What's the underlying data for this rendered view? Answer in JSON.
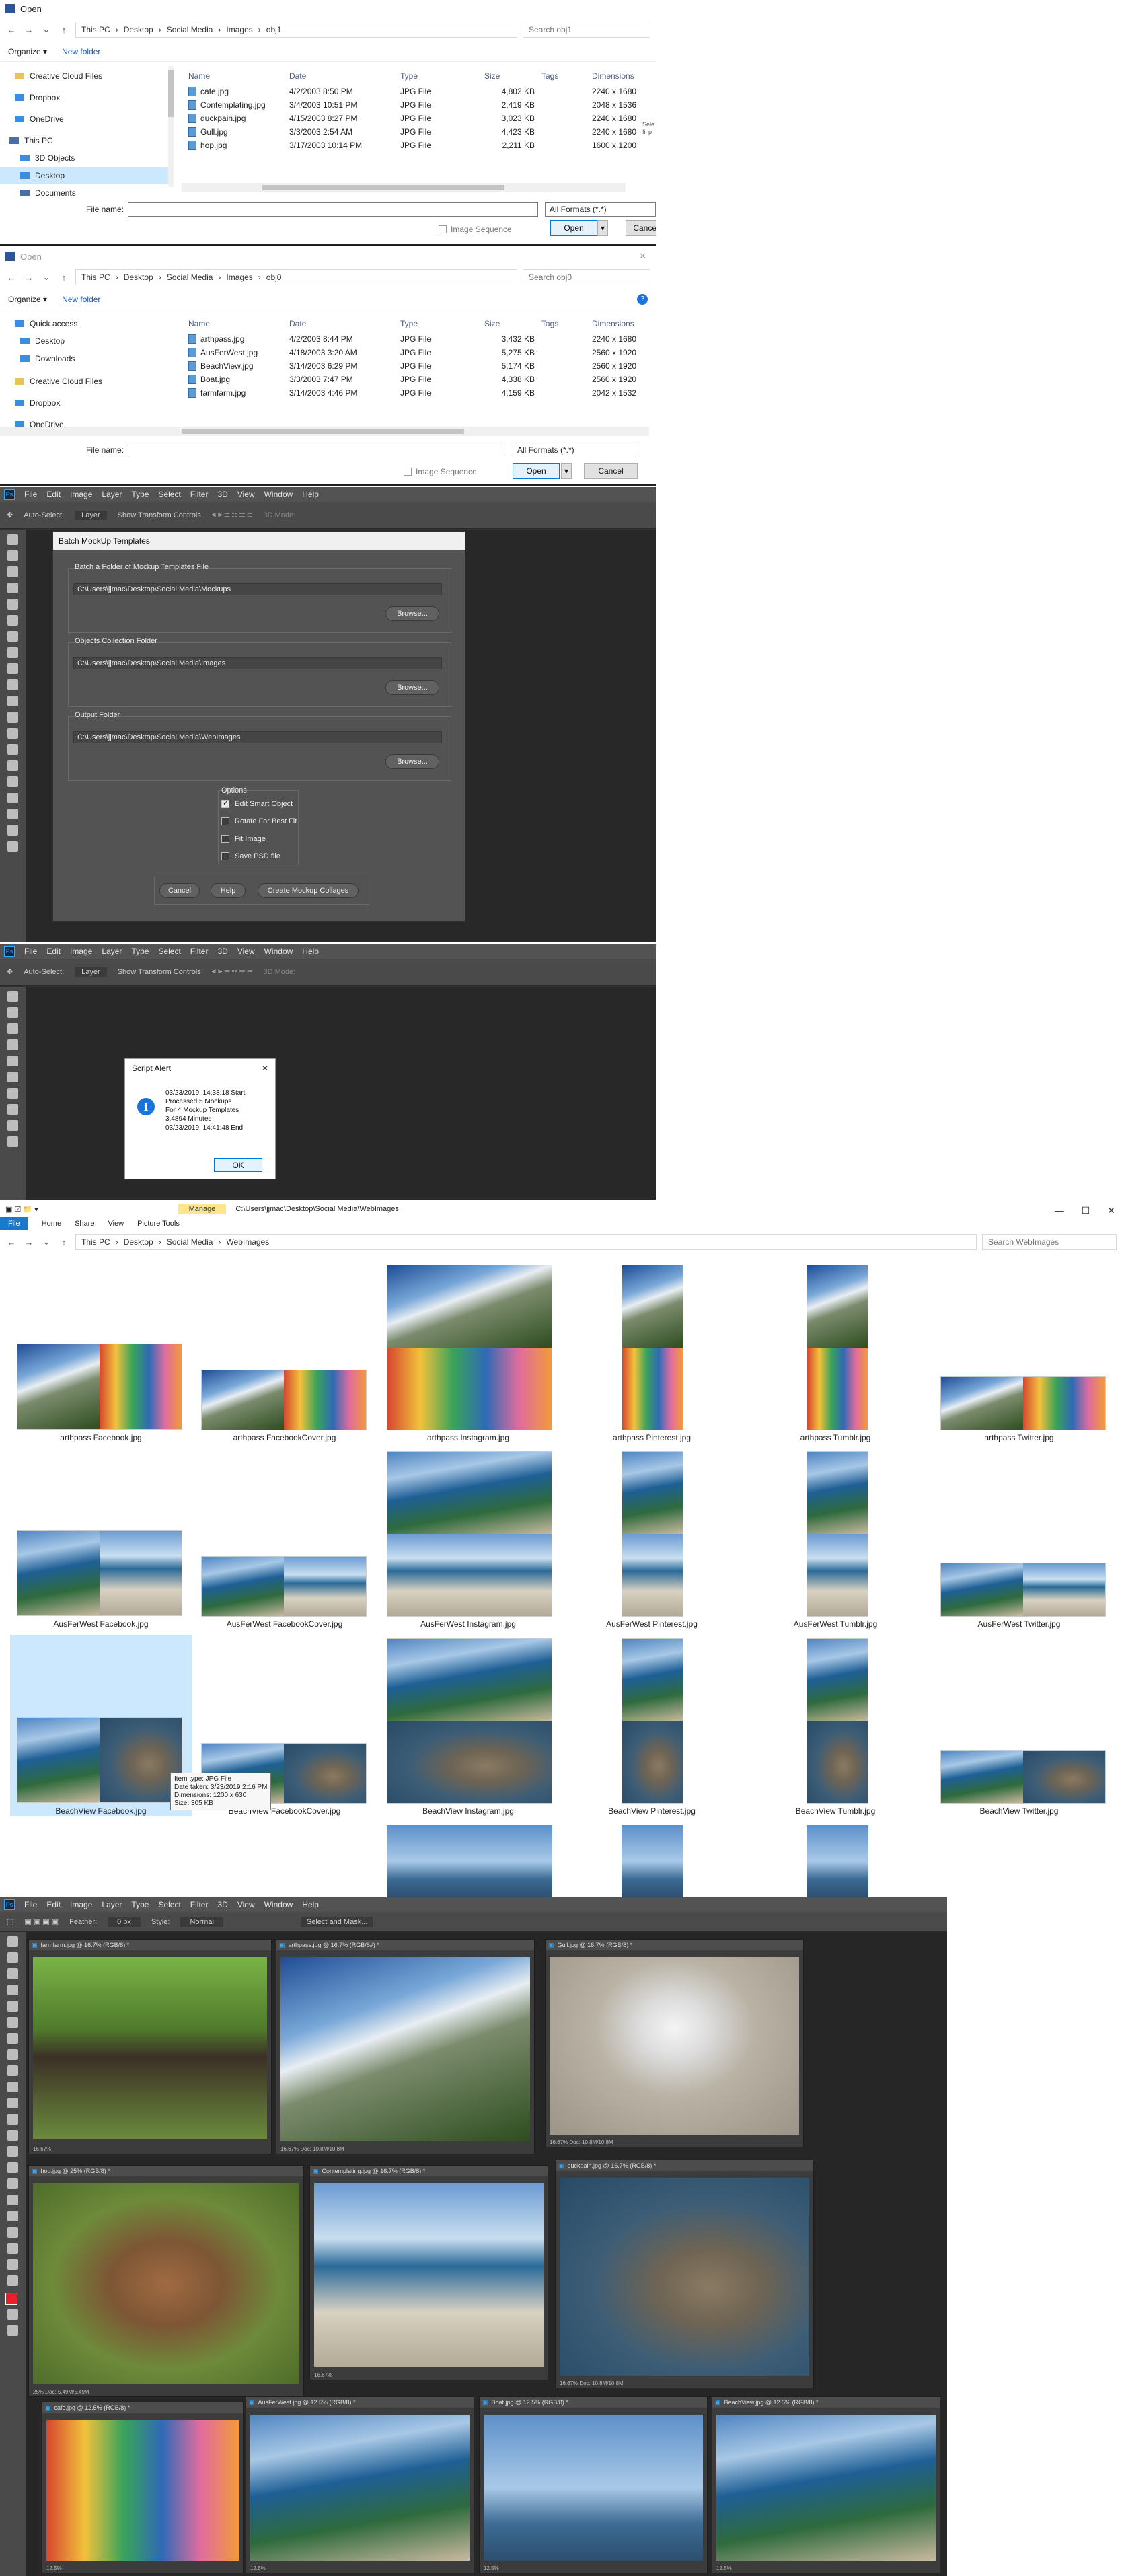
{
  "dialog1": {
    "title": "Open",
    "crumbs": [
      "This PC",
      "Desktop",
      "Social Media",
      "Images",
      "obj1"
    ],
    "search": "Search obj1",
    "organize": "Organize ▾",
    "new_folder": "New folder",
    "nav": [
      "Creative Cloud Files",
      "Dropbox",
      "OneDrive",
      "This PC",
      "3D Objects",
      "Desktop",
      "Documents"
    ],
    "headers": [
      "Name",
      "Date",
      "Type",
      "Size",
      "Tags",
      "Dimensions"
    ],
    "files": [
      {
        "name": "cafe.jpg",
        "date": "4/2/2003 8:50 PM",
        "type": "JPG File",
        "size": "4,802 KB",
        "dim": "2240 x 1680"
      },
      {
        "name": "Contemplating.jpg",
        "date": "3/4/2003 10:51 PM",
        "type": "JPG File",
        "size": "2,419 KB",
        "dim": "2048 x 1536"
      },
      {
        "name": "duckpain.jpg",
        "date": "4/15/2003 8:27 PM",
        "type": "JPG File",
        "size": "3,023 KB",
        "dim": "2240 x 1680"
      },
      {
        "name": "Gull.jpg",
        "date": "3/3/2003 2:54 AM",
        "type": "JPG File",
        "size": "4,423 KB",
        "dim": "2240 x 1680"
      },
      {
        "name": "hop.jpg",
        "date": "3/17/2003 10:14 PM",
        "type": "JPG File",
        "size": "2,211 KB",
        "dim": "1600 x 1200"
      }
    ],
    "file_name_label": "File name:",
    "formats": "All Formats (*.*)",
    "image_sequence": "Image Sequence",
    "open": "Open",
    "cancel": "Cancel",
    "preview_hint": "Sele",
    "preview_hint2": "fil p"
  },
  "dialog2": {
    "title": "Open",
    "crumbs": [
      "This PC",
      "Desktop",
      "Social Media",
      "Images",
      "obj0"
    ],
    "search": "Search obj0",
    "organize": "Organize ▾",
    "new_folder": "New folder",
    "nav": [
      "Quick access",
      "Desktop",
      "Downloads",
      "Creative Cloud Files",
      "Dropbox",
      "OneDrive"
    ],
    "headers": [
      "Name",
      "Date",
      "Type",
      "Size",
      "Tags",
      "Dimensions"
    ],
    "files": [
      {
        "name": "arthpass.jpg",
        "date": "4/2/2003 8:44 PM",
        "type": "JPG File",
        "size": "3,432 KB",
        "dim": "2240 x 1680"
      },
      {
        "name": "AusFerWest.jpg",
        "date": "4/18/2003 3:20 AM",
        "type": "JPG File",
        "size": "5,275 KB",
        "dim": "2560 x 1920"
      },
      {
        "name": "BeachView.jpg",
        "date": "3/14/2003 6:29 PM",
        "type": "JPG File",
        "size": "5,174 KB",
        "dim": "2560 x 1920"
      },
      {
        "name": "Boat.jpg",
        "date": "3/3/2003 7:47 PM",
        "type": "JPG File",
        "size": "4,338 KB",
        "dim": "2560 x 1920"
      },
      {
        "name": "farmfarm.jpg",
        "date": "3/14/2003 4:46 PM",
        "type": "JPG File",
        "size": "4,159 KB",
        "dim": "2042 x 1532"
      }
    ],
    "file_name_label": "File name:",
    "formats": "All Formats (*.*)",
    "image_sequence": "Image Sequence",
    "open": "Open",
    "cancel": "Cancel"
  },
  "ps_menu": [
    "File",
    "Edit",
    "Image",
    "Layer",
    "Type",
    "Select",
    "Filter",
    "3D",
    "View",
    "Window",
    "Help"
  ],
  "ps_opts": {
    "auto_select": "Auto-Select:",
    "layer": "Layer",
    "transform": "Show Transform Controls",
    "mode": "3D Mode:"
  },
  "batch": {
    "title": "Batch MockUp Templates",
    "mockups_label": "Batch a Folder of Mockup Templates File",
    "mockups_path": "C:\\Users\\jjmac\\Desktop\\Social Media\\Mockups",
    "objects_label": "Objects Collection Folder",
    "objects_path": "C:\\Users\\jjmac\\Desktop\\Social Media\\Images",
    "output_label": "Output Folder",
    "output_path": "C:\\Users\\jjmac\\Desktop\\Social Media\\WebImages",
    "browse": "Browse...",
    "options": "Options",
    "opt_edit": "Edit Smart Object",
    "opt_rotate": "Rotate For Best Fit",
    "opt_fit": "Fit Image",
    "opt_psd": "Save PSD file",
    "cancel": "Cancel",
    "help": "Help",
    "create": "Create Mockup Collages"
  },
  "alert": {
    "title": "Script Alert",
    "lines": [
      "03/23/2019, 14:38:18 Start",
      "Processed 5 Mockups",
      "For 4 Mockup Templates",
      "3.4894 Minutes",
      "03/23/2019, 14:41:48  End"
    ],
    "ok": "OK"
  },
  "explorer": {
    "path_title": "C:\\Users\\jjmac\\Desktop\\Social Media\\WebImages",
    "manage": "Manage",
    "ribbon": [
      "File",
      "Home",
      "Share",
      "View",
      "Picture Tools"
    ],
    "crumbs": [
      "This PC",
      "Desktop",
      "Social Media",
      "WebImages"
    ],
    "search": "Search WebImages",
    "tiles": [
      "arthpass Facebook.jpg",
      "arthpass FacebookCover.jpg",
      "arthpass Instagram.jpg",
      "arthpass Pinterest.jpg",
      "arthpass Tumblr.jpg",
      "arthpass Twitter.jpg",
      "AusFerWest Facebook.jpg",
      "AusFerWest FacebookCover.jpg",
      "AusFerWest Instagram.jpg",
      "AusFerWest Pinterest.jpg",
      "AusFerWest Tumblr.jpg",
      "AusFerWest Twitter.jpg",
      "BeachView Facebook.jpg",
      "BeachView FacebookCover.jpg",
      "BeachView Instagram.jpg",
      "BeachView Pinterest.jpg",
      "BeachView Tumblr.jpg",
      "BeachView Twitter.jpg"
    ],
    "tooltip": [
      "Item type: JPG File",
      "Date taken: 3/23/2019 2:16 PM",
      "Dimensions: 1200 x 630",
      "Size: 305 KB"
    ]
  },
  "ps2": {
    "opts": {
      "feather": "Feather:",
      "feather_val": "0 px",
      "style": "Style:",
      "style_val": "Normal",
      "select_mask": "Select and Mask..."
    },
    "docs": [
      {
        "tab": "farmfarm.jpg @ 16.7% (RGB/8) *",
        "foot": "16.67%"
      },
      {
        "tab": "arthpass.jpg @ 16.7% (RGB/8#) *",
        "foot": "16.67%   Doc: 10.8M/10.8M"
      },
      {
        "tab": "Gull.jpg @ 16.7% (RGB/8) *",
        "foot": "16.67%   Doc: 10.8M/10.8M"
      },
      {
        "tab": "hop.jpg @ 25% (RGB/8) *",
        "foot": "25%   Doc: 5.49M/5.49M"
      },
      {
        "tab": "Contemplating.jpg @ 16.7% (RGB/8) *",
        "foot": "16.67%"
      },
      {
        "tab": "duckpain.jpg @ 16.7% (RGB/8) *",
        "foot": "16.67%   Doc: 10.8M/10.8M"
      },
      {
        "tab": "cafe.jpg @ 12.5% (RGB/8) *",
        "foot": "12.5%"
      },
      {
        "tab": "AusFerWest.jpg @ 12.5% (RGB/8) *",
        "foot": "12.5%"
      },
      {
        "tab": "Boat.jpg @ 12.5% (RGB/8) *",
        "foot": "12.5%"
      },
      {
        "tab": "BeachView.jpg @ 12.5% (RGB/8) *",
        "foot": "12.5%"
      }
    ]
  }
}
